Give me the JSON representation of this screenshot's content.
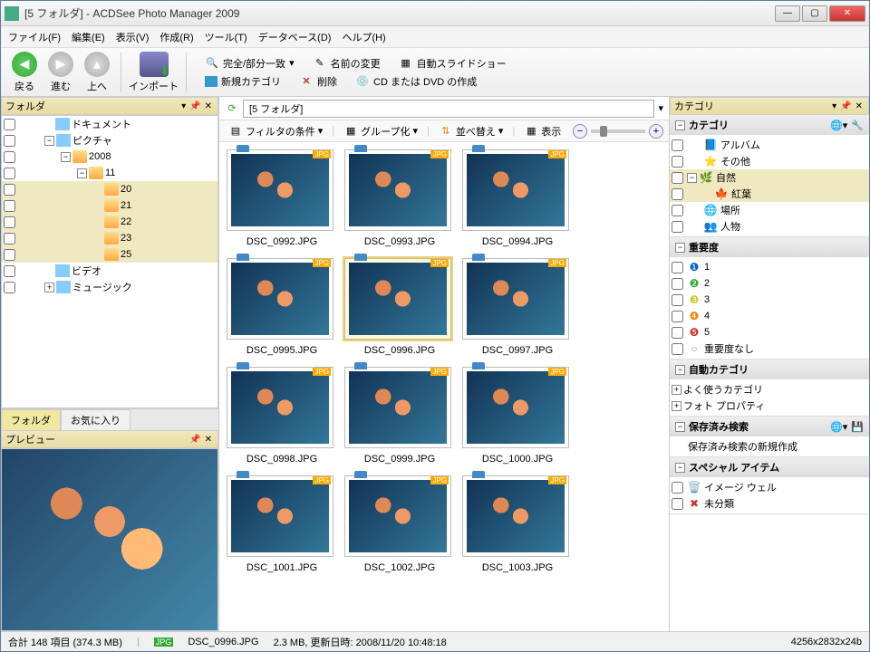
{
  "window": {
    "title": "[5 フォルダ] - ACDSee Photo Manager 2009"
  },
  "menu": {
    "file": "ファイル(F)",
    "edit": "編集(E)",
    "view": "表示(V)",
    "create": "作成(R)",
    "tool": "ツール(T)",
    "database": "データベース(D)",
    "help": "ヘルプ(H)"
  },
  "toolbar": {
    "back": "戻る",
    "forward": "進む",
    "up": "上へ",
    "import": "インポート",
    "match": "完全/部分一致",
    "rename": "名前の変更",
    "slideshow": "自動スライドショー",
    "newcat": "新規カテゴリ",
    "delete": "削除",
    "disc": "CD または DVD の作成"
  },
  "panel": {
    "folder": "フォルダ",
    "preview": "プレビュー",
    "category": "カテゴリ"
  },
  "tree": {
    "documents": "ドキュメント",
    "pictures": "ピクチャ",
    "y2008": "2008",
    "m11": "11",
    "d20": "20",
    "d21": "21",
    "d22": "22",
    "d23": "23",
    "d25": "25",
    "video": "ビデオ",
    "music": "ミュージック"
  },
  "tabs": {
    "folder": "フォルダ",
    "fav": "お気に入り"
  },
  "path": "[5 フォルダ]",
  "filterbar": {
    "filter": "フィルタの条件",
    "group": "グループ化",
    "sort": "並べ替え",
    "view": "表示"
  },
  "thumbs": [
    {
      "name": "DSC_0992.JPG"
    },
    {
      "name": "DSC_0993.JPG"
    },
    {
      "name": "DSC_0994.JPG"
    },
    {
      "name": "DSC_0995.JPG"
    },
    {
      "name": "DSC_0996.JPG"
    },
    {
      "name": "DSC_0997.JPG"
    },
    {
      "name": "DSC_0998.JPG"
    },
    {
      "name": "DSC_0999.JPG"
    },
    {
      "name": "DSC_1000.JPG"
    },
    {
      "name": "DSC_1001.JPG"
    },
    {
      "name": "DSC_1002.JPG"
    },
    {
      "name": "DSC_1003.JPG"
    }
  ],
  "cat": {
    "hdr_category": "カテゴリ",
    "album": "アルバム",
    "other": "その他",
    "nature": "自然",
    "autumn": "紅葉",
    "place": "場所",
    "people": "人物",
    "hdr_importance": "重要度",
    "i1": "1",
    "i2": "2",
    "i3": "3",
    "i4": "4",
    "i5": "5",
    "inone": "重要度なし",
    "hdr_auto": "自動カテゴリ",
    "freq": "よく使うカテゴリ",
    "photoprop": "フォト プロパティ",
    "hdr_saved": "保存済み検索",
    "newsearch": "保存済み検索の新規作成",
    "hdr_special": "スペシャル アイテム",
    "imgwell": "イメージ ウェル",
    "uncat": "未分類"
  },
  "status": {
    "total": "合計 148 項目  (374.3 MB)",
    "file": "DSC_0996.JPG",
    "detail": "2.3 MB,  更新日時:  2008/11/20  10:48:18",
    "dim": "4256x2832x24b"
  }
}
